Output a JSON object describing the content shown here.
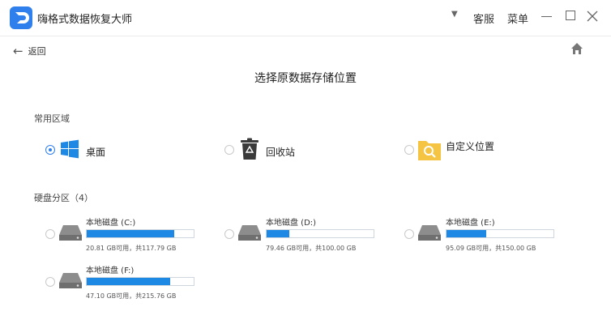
{
  "window": {
    "title": "嗨格式数据恢复大师",
    "service_label": "客服",
    "menu_label": "菜单"
  },
  "nav": {
    "back_label": "返回"
  },
  "page": {
    "title": "选择原数据存储位置"
  },
  "common": {
    "heading": "常用区域",
    "options": [
      {
        "label": "桌面",
        "selected": true,
        "icon": "windows-logo-icon"
      },
      {
        "label": "回收站",
        "selected": false,
        "icon": "recycle-bin-icon"
      },
      {
        "label": "自定义位置",
        "selected": false,
        "icon": "folder-search-icon"
      }
    ]
  },
  "drives": {
    "heading": "硬盘分区（4）",
    "items": [
      {
        "label": "本地磁盘 (C:)",
        "info": "20.81 GB可用，共117.79 GB",
        "used_fraction": 0.82
      },
      {
        "label": "本地磁盘 (D:)",
        "info": "79.46 GB可用，共100.00 GB",
        "used_fraction": 0.21
      },
      {
        "label": "本地磁盘 (E:)",
        "info": "95.09 GB可用，共150.00 GB",
        "used_fraction": 0.37
      },
      {
        "label": "本地磁盘 (F:)",
        "info": "47.10 GB可用，共215.76 GB",
        "used_fraction": 0.78
      }
    ]
  },
  "colors": {
    "accent": "#2f80ed",
    "bar_fill": "#1e88e5",
    "folder": "#f6c443"
  }
}
